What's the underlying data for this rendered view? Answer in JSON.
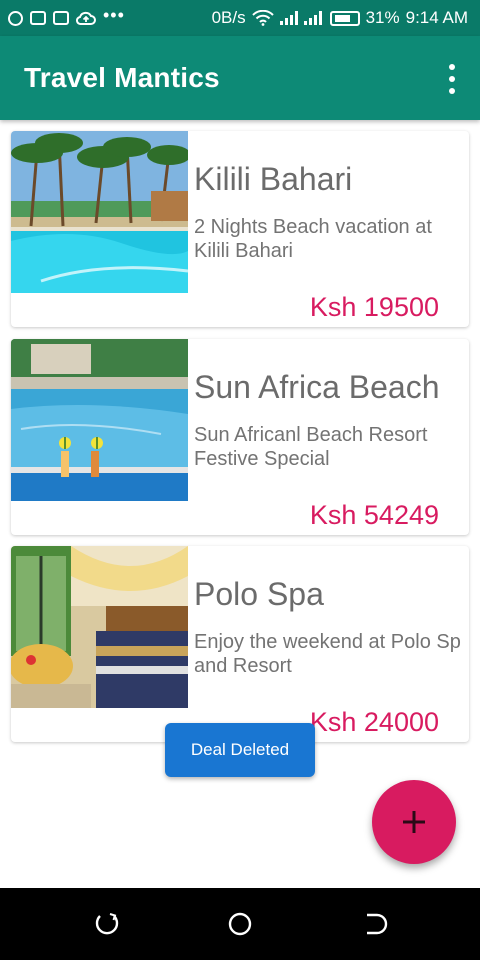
{
  "status_bar": {
    "network_speed": "0B/s",
    "battery_percent": "31%",
    "time": "9:14 AM",
    "left_icons": [
      "notification-icon",
      "mail-icon",
      "cast-icon",
      "cloud-upload-icon",
      "more-notifications-icon"
    ],
    "right_icons": [
      "wifi-icon",
      "signal-icon",
      "signal-icon",
      "battery-charging-icon"
    ]
  },
  "app_bar": {
    "title": "Travel Mantics",
    "menu_icon": "overflow-menu-icon"
  },
  "deals": [
    {
      "title": "Kilili Bahari",
      "description_line1": "2 Nights Beach vacation at",
      "description_line2": "Kilili Bahari",
      "price": "Ksh 19500",
      "image": "beach-resort-pool-photo"
    },
    {
      "title": "Sun Africa Beach",
      "description_line1": "Sun Africanl Beach Resort",
      "description_line2": "Festive Special",
      "price": "Ksh 54249",
      "image": "resort-pool-drinks-photo"
    },
    {
      "title": "Polo Spa",
      "description_line1": "Enjoy the weekend at Polo Sp",
      "description_line2": "and Resort",
      "price": "Ksh 24000",
      "image": "hotel-bedroom-photo"
    }
  ],
  "toast": {
    "message": "Deal Deleted"
  },
  "fab": {
    "icon": "add-icon"
  },
  "nav_bar": {
    "icons": [
      "recent-apps-icon",
      "home-icon",
      "back-icon"
    ]
  },
  "colors": {
    "status_bar": "#0a7a68",
    "app_bar": "#0d8a76",
    "accent": "#d81b60",
    "toast": "#1976d2",
    "title_text": "#6b6b6b"
  }
}
